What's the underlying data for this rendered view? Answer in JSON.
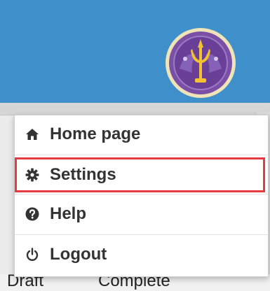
{
  "header": {
    "emblem_icon": "university-seal-icon",
    "accent_color": "#3f8fcb"
  },
  "menu": {
    "items": [
      {
        "label": "Home page",
        "icon": "home-icon"
      },
      {
        "label": "Settings",
        "icon": "gear-icon"
      },
      {
        "label": "Help",
        "icon": "question-circle-icon"
      },
      {
        "label": "Logout",
        "icon": "power-icon"
      }
    ],
    "highlight_color": "#e53a3f"
  },
  "tabs": {
    "draft_label": "Draft",
    "complete_label": "Complete"
  }
}
